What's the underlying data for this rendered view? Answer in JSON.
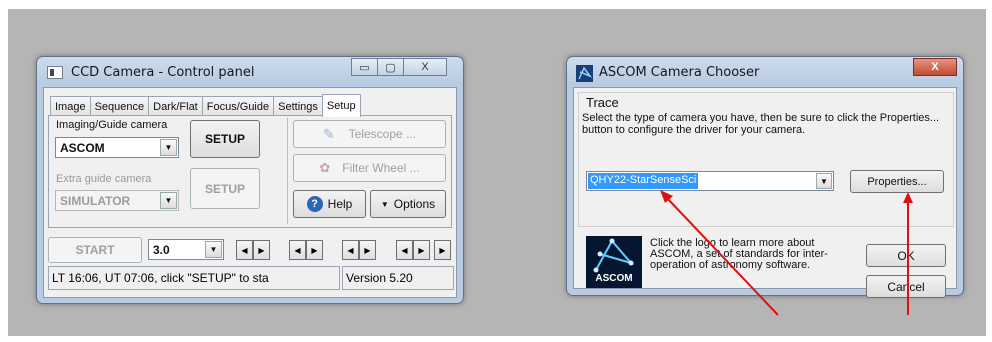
{
  "ccd": {
    "title": "CCD Camera - Control panel",
    "tabs": [
      "Image",
      "Sequence",
      "Dark/Flat",
      "Focus/Guide",
      "Settings",
      "Setup"
    ],
    "active_tab": "Setup",
    "imaging_label": "Imaging/Guide camera",
    "imaging_value": "ASCOM",
    "setup_label": "SETUP",
    "extra_label": "Extra guide camera",
    "extra_value": "SIMULATOR",
    "setup2_label": "SETUP",
    "telescope_label": "Telescope ...",
    "filter_label": "Filter Wheel ...",
    "help_label": "Help",
    "options_label": "Options",
    "start_label": "START",
    "exposure_value": "3.0",
    "status_text": "LT 16:06,  UT 07:06,  click \"SETUP\" to sta",
    "version_text": "Version 5.20"
  },
  "ascom": {
    "title": "ASCOM Camera Chooser",
    "trace_label": "Trace",
    "instructions": "Select the type of camera you have, then be sure to click the Properties... button to configure the driver for your camera.",
    "camera_value": "QHY22-StarSenseSci",
    "properties_label": "Properties...",
    "about_text": "Click the logo to learn more about ASCOM, a set of standards for inter-operation of astronomy software.",
    "logo_text": "ASCOM",
    "ok_label": "OK",
    "cancel_label": "Cancel"
  },
  "icons": {
    "help": "?",
    "options_arrow": "▼",
    "combo_arrow": "▼",
    "arrow_left": "◀",
    "arrow_right": "▶",
    "minimize": "▭",
    "maximize": "▢",
    "close": "X"
  },
  "colors": {
    "annotation_arrow": "#e01010",
    "selection": "#3399ff"
  }
}
